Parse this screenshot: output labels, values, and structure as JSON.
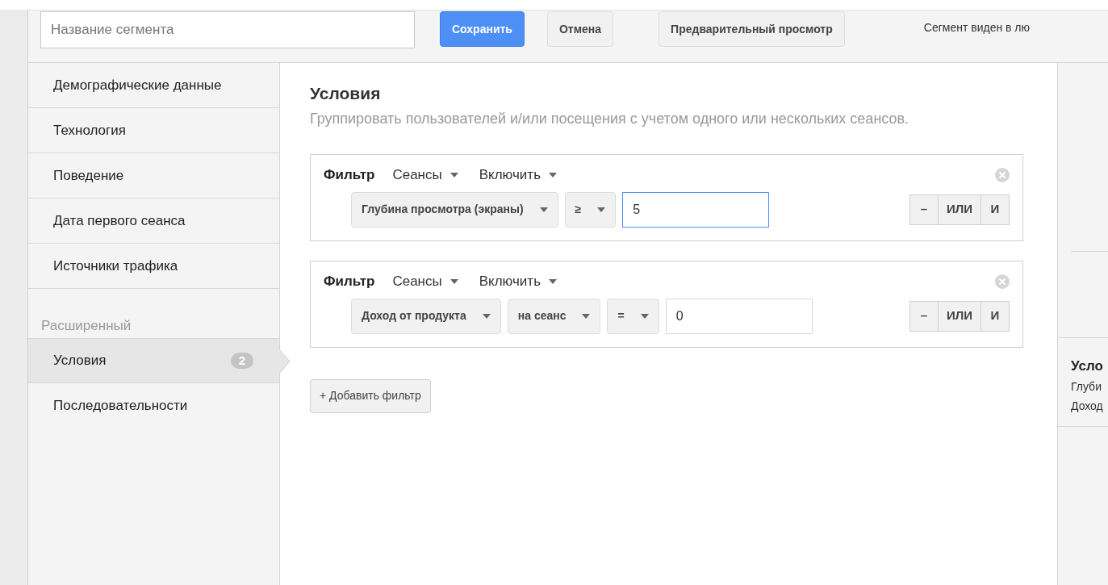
{
  "header": {
    "name_field": {
      "placeholder": "Название сегмента"
    },
    "buttons": [
      {
        "label": "Сохранить",
        "kind": "primary"
      },
      {
        "label": "Отмена",
        "kind": "secondary"
      },
      {
        "label": "Предварительный просмотр",
        "kind": "secondary"
      }
    ],
    "visibility_text": "Сегмент виден в лю"
  },
  "sidebar": {
    "groups": [
      {
        "items": [
          {
            "label": "Демографические данные",
            "selected": false
          },
          {
            "label": "Технология",
            "selected": false
          },
          {
            "label": "Поведение",
            "selected": false
          },
          {
            "label": "Дата первого сеанса",
            "selected": false
          },
          {
            "label": "Источники трафика",
            "selected": false
          }
        ]
      },
      {
        "title": "Расширенный",
        "items": [
          {
            "label": "Условия",
            "selected": true,
            "badge": "2"
          },
          {
            "label": "Последовательности",
            "selected": false
          }
        ]
      }
    ]
  },
  "main": {
    "title": "Условия",
    "subtitle": "Группировать пользователей и/или посещения с учетом одного или нескольких сеансов.",
    "filters": [
      {
        "label": "Фильтр",
        "scope": "Сеансы",
        "mode": "Включить",
        "controls": [
          {
            "kind": "dropdown",
            "text": "Глубина просмотра (экраны)"
          },
          {
            "kind": "dropdown",
            "text": "≥"
          },
          {
            "kind": "input",
            "value": "5",
            "focused": true
          }
        ],
        "logic": [
          "–",
          "ИЛИ",
          "И"
        ]
      },
      {
        "label": "Фильтр",
        "scope": "Сеансы",
        "mode": "Включить",
        "controls": [
          {
            "kind": "dropdown",
            "text": "Доход от продукта"
          },
          {
            "kind": "dropdown",
            "text": "на сеанс"
          },
          {
            "kind": "dropdown",
            "text": "="
          },
          {
            "kind": "input",
            "value": "0",
            "focused": false
          }
        ],
        "logic": [
          "–",
          "ИЛИ",
          "И"
        ]
      }
    ],
    "add_button": "+ Добавить фильтр"
  },
  "summary": {
    "title": "Усло",
    "lines": [
      "Глуби",
      "Доход"
    ]
  }
}
